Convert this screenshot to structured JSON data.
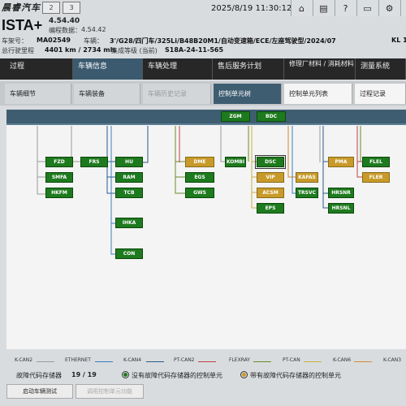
{
  "watermark": "晨睿汽车",
  "top": {
    "pages": [
      "2",
      "3"
    ],
    "datetime": "2025/8/19 11:30:12",
    "icons": [
      "home-icon",
      "print-icon",
      "help-icon",
      "monitor-icon",
      "settings-icon",
      "close-icon"
    ]
  },
  "app": {
    "title": "ISTA+",
    "version": "4.54.40",
    "data_version_label": "编程数据：",
    "data_version": "4.54.42"
  },
  "vehicle": {
    "vin_label": "车架号：",
    "vin": "MA02549",
    "vehicle_label": "车辆：",
    "vehicle": "3'/G28/四门车/325Li/B48B20M1/自动变速箱/ECE/左座驾驶型/2024/07",
    "kl_label": "KL 1",
    "mileage_label": "总行驶里程",
    "mileage": "4401 km / 2734 mls",
    "integration_label": "集成等级 (当前)",
    "integration": "S18A-24-11-565"
  },
  "tabs1": [
    {
      "label": "过程"
    },
    {
      "label": "车辆信息"
    },
    {
      "label": "车辆处理"
    },
    {
      "label": "售后服务计划"
    },
    {
      "label": "修理厂材料 / 消耗材料"
    },
    {
      "label": "测量系统"
    }
  ],
  "tabs2": [
    {
      "label": "车辆细节"
    },
    {
      "label": "车辆装备"
    },
    {
      "label": "车辆历史记录"
    },
    {
      "label": "控制单元树"
    },
    {
      "label": "控制单元列表"
    },
    {
      "label": "过程记录"
    }
  ],
  "ecus": [
    "ZGM",
    "BDC",
    "FZD",
    "SMFA",
    "HKFM",
    "FRS",
    "HU",
    "RAM",
    "TCB",
    "IHKA",
    "CON",
    "DME",
    "EGS",
    "GWS",
    "KOMBI",
    "DSC",
    "VIP",
    "ACSM",
    "EPS",
    "KAFAS",
    "TRSVC",
    "PMA",
    "HRSNR",
    "HRSNL",
    "FLEL",
    "FLER"
  ],
  "colors": {
    "ecu_ok": "#1e7a1e",
    "ecu_fault": "#c89a2a",
    "bus": "#3e5d71"
  },
  "legend": [
    {
      "label": "K-CAN2",
      "color": "#9a9a9a"
    },
    {
      "label": "ETHERNET",
      "color": "#3a7fc0"
    },
    {
      "label": "K-CAN4",
      "color": "#2a5a8a"
    },
    {
      "label": "PT-CAN2",
      "color": "#c04040"
    },
    {
      "label": "FLEXRAY",
      "color": "#6a8a2a"
    },
    {
      "label": "PT-CAN",
      "color": "#c8b040"
    },
    {
      "label": "K-CAN6",
      "color": "#d08a30"
    },
    {
      "label": "K-CAN3",
      "color": "#4a4a4a"
    }
  ],
  "footer": {
    "fault_label": "故障代码存储器",
    "fault_count": "19 / 19",
    "no_fault_text": "没有故障代码存储器的控制单元",
    "has_fault_text": "带有故障代码存储器的控制单元"
  },
  "buttons": {
    "start_test": "启动车辆测试",
    "call_list": "调用控制单元功能"
  }
}
